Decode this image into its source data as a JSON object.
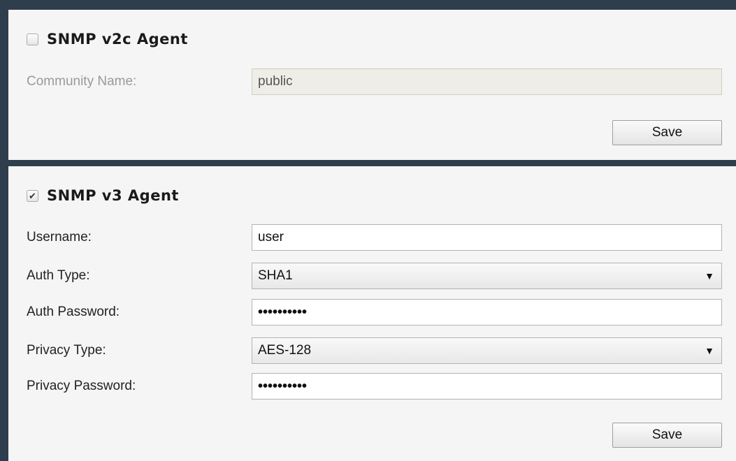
{
  "v2c": {
    "title": "SNMP v2c Agent",
    "enabled": false,
    "community_label": "Community Name:",
    "community_value": "public",
    "save_label": "Save"
  },
  "v3": {
    "title": "SNMP v3 Agent",
    "enabled": true,
    "username_label": "Username:",
    "username_value": "user",
    "auth_type_label": "Auth Type:",
    "auth_type_value": "SHA1",
    "auth_password_label": "Auth Password:",
    "auth_password_value": "••••••••••",
    "privacy_type_label": "Privacy Type:",
    "privacy_type_value": "AES-128",
    "privacy_password_label": "Privacy Password:",
    "privacy_password_value": "••••••••••",
    "save_label": "Save"
  },
  "icons": {
    "checkbox_checked": "check-icon",
    "select_arrow": "dropdown-arrow-icon"
  },
  "colors": {
    "frame": "#2f3e4c",
    "panel": "#f5f5f5",
    "disabled_input": "#efeee6"
  }
}
